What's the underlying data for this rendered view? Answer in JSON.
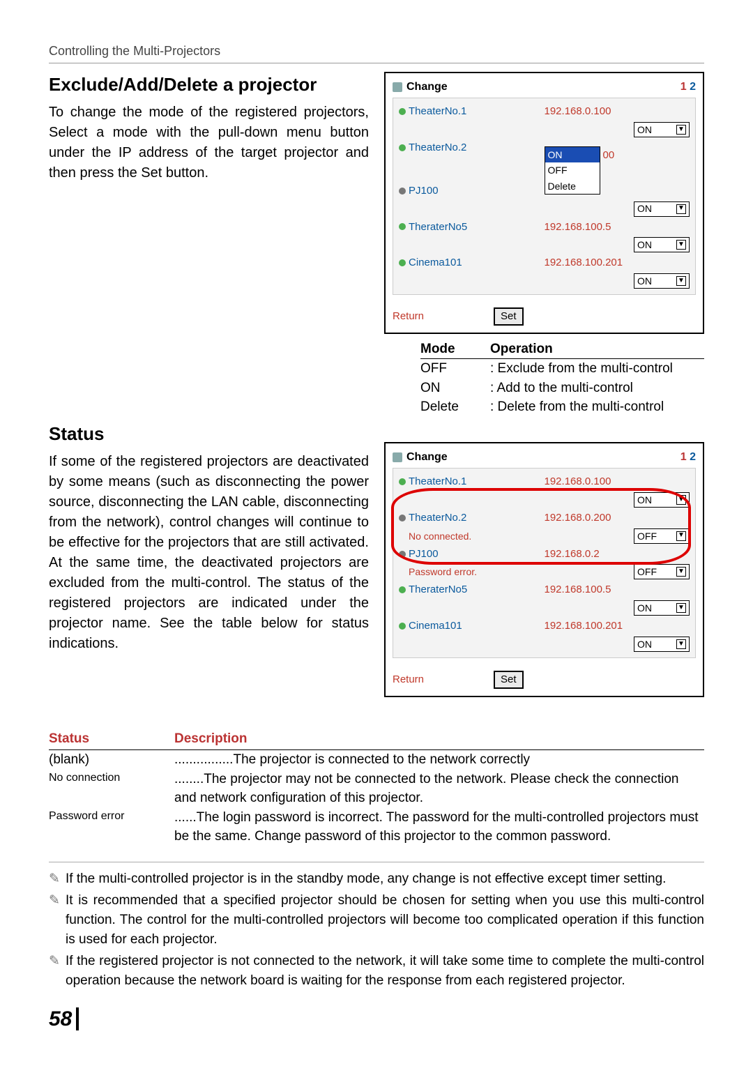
{
  "breadcrumb": "Controlling the Multi-Projectors",
  "section1": {
    "title": "Exclude/Add/Delete a projector",
    "body": "To change the mode of the registered projectors, Select a mode with the pull-down menu button under the IP address of the target projector and then press the Set button."
  },
  "section2": {
    "title": "Status",
    "body": "If some of the registered projectors are deactivated by some means (such as disconnecting the power source, disconnecting the LAN cable, disconnecting from the network), control changes will continue to be effective for the projectors that are still activated. At the same time, the deactivated projectors are excluded from the multi-control. The status of the registered projectors are indicated under the projector name. See the table below for status indications."
  },
  "window1": {
    "title": "Change",
    "pages": [
      "1",
      "2"
    ],
    "rows": [
      {
        "name": "TheaterNo.1",
        "dot": "green",
        "ip": "192.168.0.100",
        "mode": "ON"
      },
      {
        "name": "TheaterNo.2",
        "dot": "green",
        "ip_over": "00",
        "open": true,
        "opts": [
          "ON",
          "OFF",
          "Delete"
        ]
      },
      {
        "name": "PJ100",
        "dot": "gray",
        "ip": "",
        "mode": "ON"
      },
      {
        "name": "TheraterNo5",
        "dot": "green",
        "ip": "192.168.100.5",
        "mode": "ON"
      },
      {
        "name": "Cinema101",
        "dot": "green",
        "ip": "192.168.100.201",
        "mode": "ON"
      }
    ],
    "return": "Return",
    "set": "Set"
  },
  "mode_table": {
    "hdr": [
      "Mode",
      "Operation"
    ],
    "rows": [
      [
        "OFF",
        ": Exclude from the multi-control"
      ],
      [
        "ON",
        ": Add to the multi-control"
      ],
      [
        "Delete",
        ": Delete from the multi-control"
      ]
    ]
  },
  "window2": {
    "title": "Change",
    "pages": [
      "1",
      "2"
    ],
    "rows": [
      {
        "name": "TheaterNo.1",
        "dot": "green",
        "ip": "192.168.0.100",
        "mode": "ON"
      },
      {
        "name": "TheaterNo.2",
        "dot": "gray",
        "status": "No connected.",
        "ip": "192.168.0.200",
        "mode": "OFF"
      },
      {
        "name": "PJ100",
        "dot": "gray",
        "status": "Password error.",
        "ip": "192.168.0.2",
        "mode": "OFF"
      },
      {
        "name": "TheraterNo5",
        "dot": "green",
        "ip": "192.168.100.5",
        "mode": "ON"
      },
      {
        "name": "Cinema101",
        "dot": "green",
        "ip": "192.168.100.201",
        "mode": "ON"
      }
    ],
    "return": "Return",
    "set": "Set"
  },
  "status_table": {
    "hdr": [
      "Status",
      "Description"
    ],
    "rows": [
      {
        "k": "(blank)",
        "v": "................The projector is connected to the network correctly"
      },
      {
        "k": "No connection",
        "v": "........The projector may not be connected to the network. Please check the connection and network configuration of this projector."
      },
      {
        "k": "Password error",
        "v": "......The login password is incorrect. The password for the multi-controlled projectors must be the same. Change password of this projector to the common password."
      }
    ]
  },
  "notes": [
    "If the multi-controlled projector is in the standby mode, any change is not effective except timer setting.",
    "It is recommended that a specified projector should be chosen for setting when you use this multi-control function. The control for the multi-controlled projectors will become too complicated operation if this function is used for each projector.",
    "If the registered projector is not connected to the network, it will take some time to complete the multi-control operation because the network board is waiting for the response from each registered projector."
  ],
  "pagenum": "58"
}
